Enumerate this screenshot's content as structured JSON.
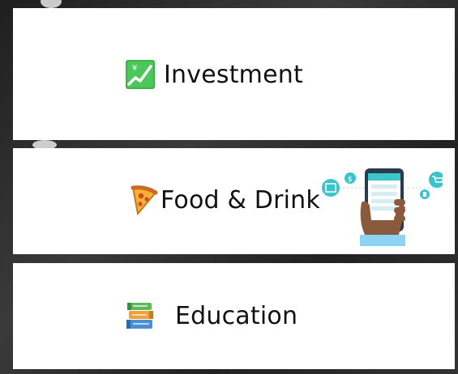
{
  "cards": [
    {
      "label": "Investment",
      "icon": "chart-increasing-yen-icon"
    },
    {
      "label": "Food & Drink",
      "icon": "pizza-icon"
    },
    {
      "label": "Education",
      "icon": "books-icon"
    }
  ],
  "colors": {
    "accent": "#3cc4cc",
    "card": "#ffffff",
    "background": "#2a2a2a"
  },
  "illustration": "phone-payment-illustration"
}
